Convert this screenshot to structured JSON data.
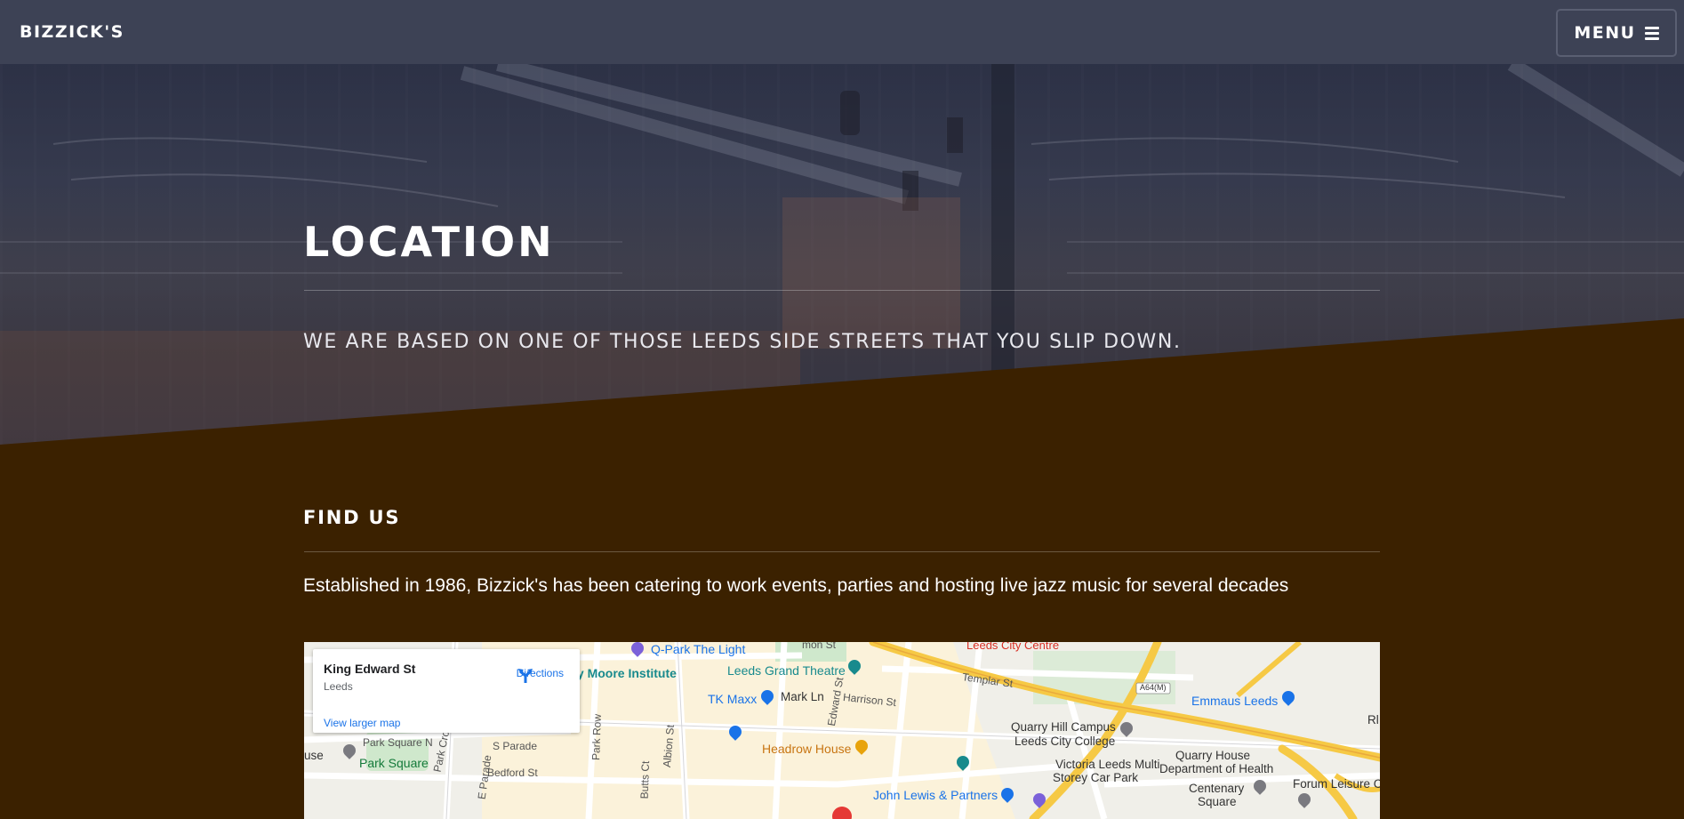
{
  "navbar": {
    "brand": "BIZZICK'S",
    "menu_label": "MENU"
  },
  "hero": {
    "title": "LOCATION",
    "subtitle": "WE ARE BASED ON ONE OF THOSE LEEDS SIDE STREETS THAT YOU SLIP DOWN."
  },
  "find_us": {
    "title": "FIND US",
    "text": "Established in 1986, Bizzick's has been catering to work events, parties and hosting live jazz music for several decades"
  },
  "map": {
    "card": {
      "title": "King Edward St",
      "subtitle": "Leeds",
      "directions": "Directions",
      "view_larger": "View larger map"
    },
    "labels": {
      "q_park": "Q-Park The Light",
      "henry_moore": "Henry Moore Institute",
      "leeds_grand": "Leeds Grand Theatre",
      "leeds_city_centre": "Leeds City Centre",
      "templar": "Templar St",
      "a64m": "A64(M)",
      "emmaus": "Emmaus Leeds",
      "tk_maxx": "TK Maxx",
      "mark_ln": "Mark Ln",
      "harrison": "Harrison St",
      "edward": "Edward St",
      "quarry_hill": "Quarry Hill Campus",
      "leeds_city_college": "Leeds City College",
      "park_square_n": "Park Square N",
      "park_square": "Park Square",
      "s_parade": "S Parade",
      "headrow": "Headrow House",
      "bedford": "Bedford St",
      "e_parade": "E Parade",
      "park_row": "Park Row",
      "albion": "Albion St",
      "butts_ct": "Butts Ct",
      "park_cross": "Park Cross",
      "victoria": "Victoria Leeds Multi",
      "victoria2": "Storey Car Park",
      "quarry_house": "Quarry House",
      "dept_health": "Department of Health",
      "centenary": "Centenary",
      "centenary2": "Square",
      "forum": "Forum Leisure Ce",
      "john_lewis": "John Lewis & Partners",
      "use": "use",
      "st_frag": "mon St",
      "rl": "Rl"
    }
  }
}
